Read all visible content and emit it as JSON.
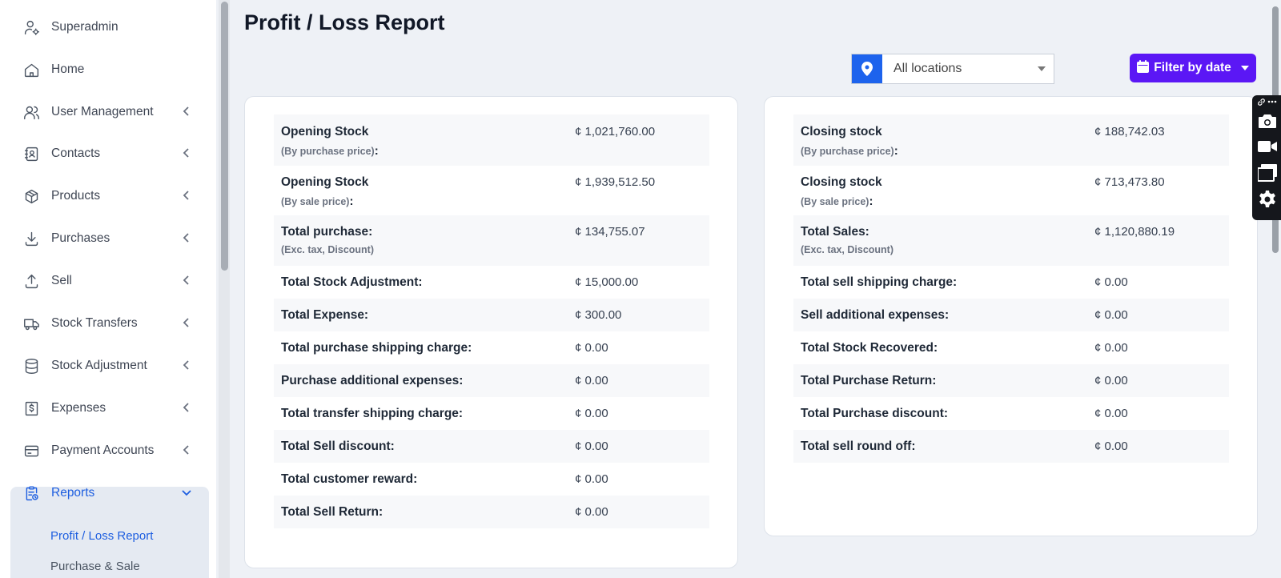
{
  "sidebar": {
    "items": [
      {
        "label": "Superadmin",
        "icon": "user-gear-icon"
      },
      {
        "label": "Home",
        "icon": "home-icon"
      },
      {
        "label": "User Management",
        "icon": "users-icon"
      },
      {
        "label": "Contacts",
        "icon": "address-book-icon"
      },
      {
        "label": "Products",
        "icon": "box-icon"
      },
      {
        "label": "Purchases",
        "icon": "download-icon"
      },
      {
        "label": "Sell",
        "icon": "upload-icon"
      },
      {
        "label": "Stock Transfers",
        "icon": "truck-icon"
      },
      {
        "label": "Stock Adjustment",
        "icon": "database-icon"
      },
      {
        "label": "Expenses",
        "icon": "dollar-receipt-icon"
      },
      {
        "label": "Payment Accounts",
        "icon": "credit-card-icon"
      },
      {
        "label": "Reports",
        "icon": "clipboard-report-icon"
      }
    ],
    "reports_sub": [
      "Profit / Loss Report",
      "Purchase & Sale"
    ]
  },
  "page": {
    "title": "Profit / Loss Report",
    "location_select": "All locations",
    "filter_button": "Filter by date"
  },
  "left_card": [
    {
      "label": "Opening Stock",
      "sub": "(By purchase price)",
      "colon": ":",
      "value": "¢ 1,021,760.00"
    },
    {
      "label": "Opening Stock",
      "sub": "(By sale price)",
      "colon": ":",
      "value": "¢ 1,939,512.50"
    },
    {
      "label": "Total purchase:",
      "sub": "(Exc. tax, Discount)",
      "colon": "",
      "value": "¢ 134,755.07"
    },
    {
      "label": "Total Stock Adjustment:",
      "value": "¢ 15,000.00"
    },
    {
      "label": "Total Expense:",
      "value": "¢ 300.00"
    },
    {
      "label": "Total purchase shipping charge:",
      "value": "¢ 0.00"
    },
    {
      "label": "Purchase additional expenses:",
      "value": "¢ 0.00"
    },
    {
      "label": "Total transfer shipping charge:",
      "value": "¢ 0.00"
    },
    {
      "label": "Total Sell discount:",
      "value": "¢ 0.00"
    },
    {
      "label": "Total customer reward:",
      "value": "¢ 0.00"
    },
    {
      "label": "Total Sell Return:",
      "value": "¢ 0.00"
    }
  ],
  "right_card": [
    {
      "label": "Closing stock",
      "sub": "(By purchase price)",
      "colon": ":",
      "value": "¢ 188,742.03"
    },
    {
      "label": "Closing stock",
      "sub": "(By sale price)",
      "colon": ":",
      "value": "¢ 713,473.80"
    },
    {
      "label": "Total Sales:",
      "sub": "(Exc. tax, Discount)",
      "colon": "",
      "value": "¢ 1,120,880.19"
    },
    {
      "label": "Total sell shipping charge:",
      "value": "¢ 0.00"
    },
    {
      "label": "Sell additional expenses:",
      "value": "¢ 0.00"
    },
    {
      "label": "Total Stock Recovered:",
      "value": "¢ 0.00"
    },
    {
      "label": "Total Purchase Return:",
      "value": "¢ 0.00"
    },
    {
      "label": "Total Purchase discount:",
      "value": "¢ 0.00"
    },
    {
      "label": "Total sell round off:",
      "value": "¢ 0.00"
    }
  ],
  "colors": {
    "accent": "#1d5ee0",
    "filter_button": "#5b17f5",
    "location_icon_bg": "#1d63ed"
  },
  "floating_toolbar": [
    "link-icon",
    "more-icon",
    "camera-icon",
    "video-icon",
    "windows-icon",
    "gear-icon"
  ]
}
